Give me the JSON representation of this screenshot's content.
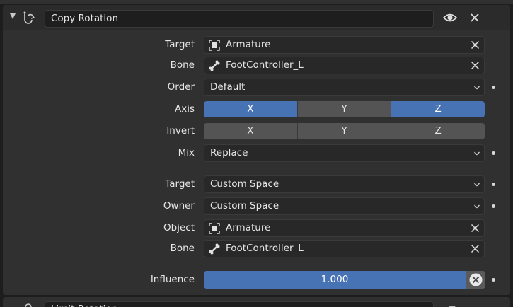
{
  "constraint": {
    "name": "Copy Rotation",
    "icon": "constraint-icon"
  },
  "rows": {
    "target_label": "Target",
    "target_value": "Armature",
    "bone_label": "Bone",
    "bone_value": "FootController_L",
    "order_label": "Order",
    "order_value": "Default",
    "axis_label": "Axis",
    "axis": [
      {
        "label": "X",
        "active": true
      },
      {
        "label": "Y",
        "active": false
      },
      {
        "label": "Z",
        "active": true
      }
    ],
    "invert_label": "Invert",
    "invert": [
      {
        "label": "X",
        "active": false
      },
      {
        "label": "Y",
        "active": false
      },
      {
        "label": "Z",
        "active": false
      }
    ],
    "mix_label": "Mix",
    "mix_value": "Replace",
    "target_space_label": "Target",
    "target_space_value": "Custom Space",
    "owner_space_label": "Owner",
    "owner_space_value": "Custom Space",
    "object_label": "Object",
    "object_value": "Armature",
    "bone2_label": "Bone",
    "bone2_value": "FootController_L",
    "influence_label": "Influence",
    "influence_value": "1.000",
    "influence_fraction": 1.0
  },
  "next_constraint": {
    "name": "Limit Rotation"
  },
  "colors": {
    "accent": "#4772b3",
    "panel": "#303030",
    "field": "#282828",
    "button": "#545454"
  }
}
